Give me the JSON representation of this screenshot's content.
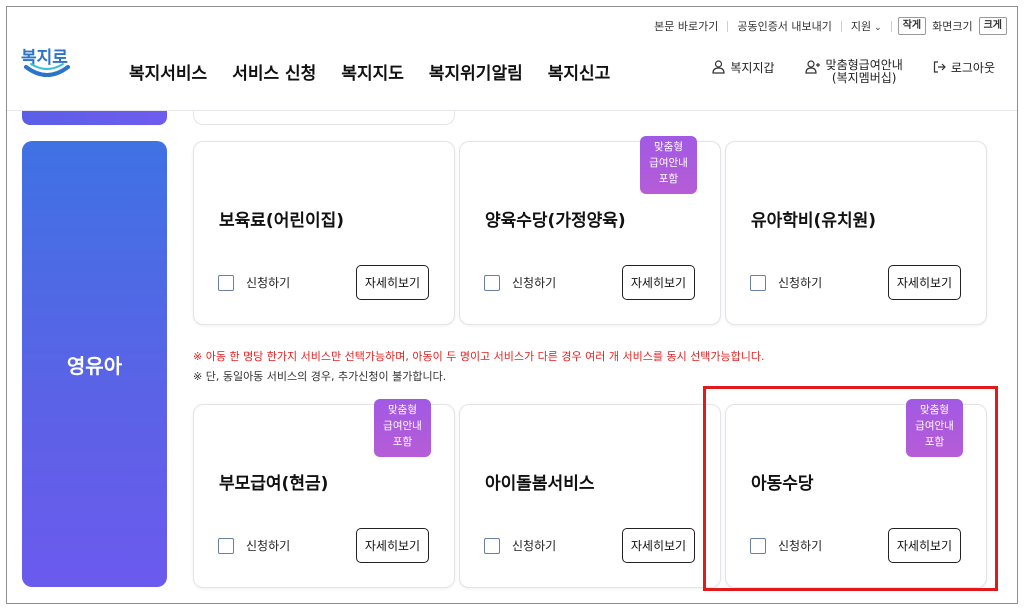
{
  "util_links": {
    "skip_to_content": "본문 바로가기",
    "cert_export": "공동인증서 내보내기",
    "support": "지원",
    "support_chevron": "⌄",
    "font_small": "작게",
    "font_size_label": "화면크기",
    "font_large": "크게"
  },
  "logo": {
    "text": "복지로"
  },
  "gnb": [
    "복지서비스",
    "서비스 신청",
    "복지지도",
    "복지위기알림",
    "복지신고"
  ],
  "user_menu": {
    "wallet": "복지지갑",
    "membership_line1": "맞춤형급여안내",
    "membership_line2": "(복지멤버십)",
    "logout": "로그아웃"
  },
  "side_tab": {
    "label": "영유아"
  },
  "cards": [
    {
      "title": "보육료(어린이집)",
      "apply_label": "신청하기",
      "detail_label": "자세히보기",
      "badge": false
    },
    {
      "title": "양육수당(가정양육)",
      "apply_label": "신청하기",
      "detail_label": "자세히보기",
      "badge": true
    },
    {
      "title": "유아학비(유치원)",
      "apply_label": "신청하기",
      "detail_label": "자세히보기",
      "badge": false
    },
    {
      "title": "부모급여(현금)",
      "apply_label": "신청하기",
      "detail_label": "자세히보기",
      "badge": true
    },
    {
      "title": "아이돌봄서비스",
      "apply_label": "신청하기",
      "detail_label": "자세히보기",
      "badge": false
    },
    {
      "title": "아동수당",
      "apply_label": "신청하기",
      "detail_label": "자세히보기",
      "badge": true
    }
  ],
  "badge_text": {
    "line1": "맞춤형",
    "line2": "급여안내",
    "line3": "포함"
  },
  "notice": {
    "line1": "※ 아동 한 명당 한가지 서비스만 선택가능하며, 아동이 두 명이고 서비스가 다른 경우 여러 개 서비스를 동시 선택가능합니다.",
    "line2": "※ 단, 동일아동 서비스의 경우, 추가신청이 불가합니다."
  },
  "colors": {
    "brand_blue": "#2b74c9",
    "tab_gradient_top": "#3f72e4",
    "tab_gradient_bottom": "#6b5aee",
    "badge_purple": "#a15ae4",
    "notice_red": "#e51f1f",
    "highlight_red": "#e11b1b"
  }
}
